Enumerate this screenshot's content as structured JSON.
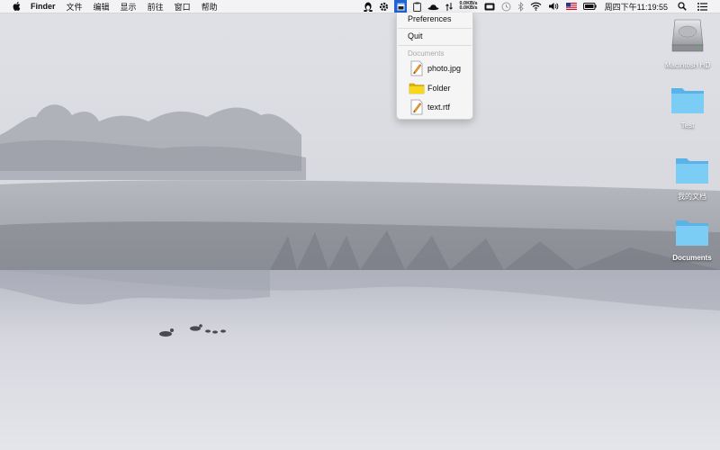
{
  "menubar": {
    "app_name": "Finder",
    "menus": [
      "文件",
      "编辑",
      "显示",
      "前往",
      "窗口",
      "帮助"
    ],
    "netspeed_up": "0.0KB/s",
    "netspeed_down": "0.0KB/s",
    "clock": "周四下午11:19:55",
    "tray_icons": [
      "qq-penguin-icon",
      "gear-icon",
      "app-window-icon",
      "clipboard-icon",
      "bowler-hat-icon",
      "network-arrows-icon",
      "battery-meter-icon",
      "time-machine-icon",
      "bluetooth-icon",
      "wifi-icon",
      "volume-icon",
      "us-flag-icon",
      "battery-icon",
      "spotlight-search-icon",
      "notification-list-icon"
    ]
  },
  "dropdown": {
    "preferences": "Preferences",
    "quit": "Quit",
    "section_header": "Documents",
    "files": [
      {
        "name": "photo.jpg",
        "icon": "document-pencil-icon"
      },
      {
        "name": "Folder",
        "icon": "yellow-folder-icon"
      },
      {
        "name": "text.rtf",
        "icon": "document-pencil-icon"
      }
    ]
  },
  "desktop": {
    "icons": [
      {
        "label": "Macintosh HD",
        "icon": "hard-drive-icon"
      },
      {
        "label": "Test",
        "icon": "folder-icon"
      },
      {
        "label": "我的文档",
        "icon": "folder-icon"
      },
      {
        "label": "Documents",
        "icon": "folder-icon"
      }
    ]
  },
  "colors": {
    "menubar_highlight": "#1f64d6",
    "folder_blue": "#6cc3f2",
    "folder_yellow": "#f5d020"
  }
}
